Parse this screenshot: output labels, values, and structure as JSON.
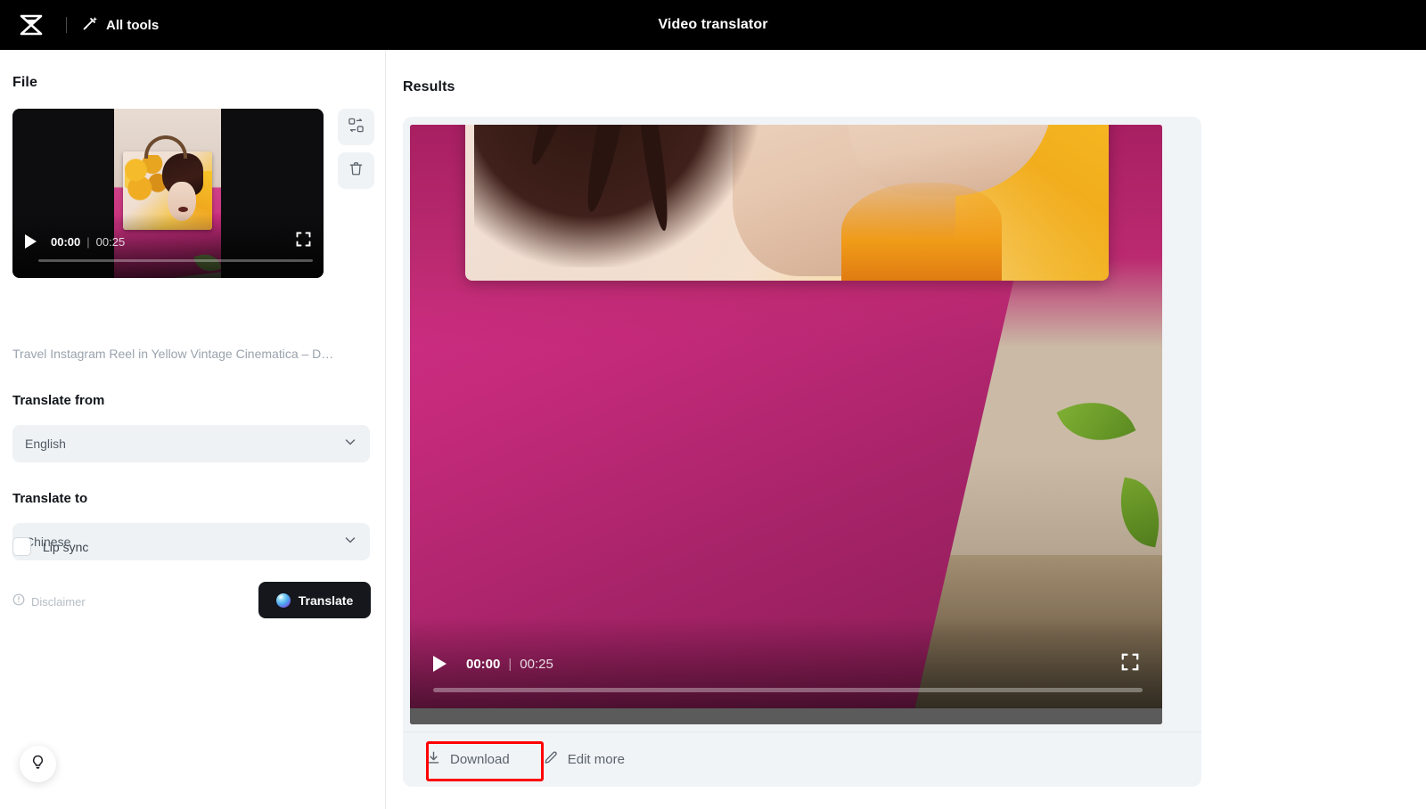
{
  "topbar": {
    "logo_icon": "capcut-logo-icon",
    "all_tools_icon": "magic-wand-icon",
    "all_tools_label": "All tools",
    "title": "Video translator"
  },
  "left_panel": {
    "file_section_title": "File",
    "file_preview": {
      "play_icon": "play-icon",
      "current_time": "00:00",
      "time_separator": "|",
      "total_time": "00:25",
      "fullscreen_icon": "fullscreen-icon"
    },
    "file_actions": [
      {
        "icon": "replace-media-icon",
        "name": "replace-file-button"
      },
      {
        "icon": "trash-icon",
        "name": "delete-file-button"
      }
    ],
    "file_name": "Travel Instagram Reel in Yellow Vintage Cinematica – D…",
    "translate_from": {
      "label": "Translate from",
      "value": "English",
      "chevron_icon": "chevron-down-icon"
    },
    "translate_to": {
      "label": "Translate to",
      "value": "Chinese",
      "chevron_icon": "chevron-down-icon"
    },
    "lip_sync": {
      "label": "Lip sync",
      "checked": false
    },
    "disclaimer": {
      "icon": "info-icon",
      "label": "Disclaimer"
    },
    "translate_button": {
      "icon": "ai-sphere-icon",
      "label": "Translate",
      "background": "#15171d"
    },
    "help_button": {
      "icon": "lightbulb-icon"
    }
  },
  "results": {
    "title": "Results",
    "player": {
      "play_icon": "play-icon",
      "current_time": "00:00",
      "time_separator": "|",
      "total_time": "00:25",
      "fullscreen_icon": "fullscreen-icon"
    },
    "actions": [
      {
        "icon": "download-icon",
        "label": "Download",
        "name": "download-button",
        "highlighted": true
      },
      {
        "icon": "pencil-icon",
        "label": "Edit more",
        "name": "edit-more-button",
        "highlighted": false
      }
    ],
    "highlight_color": "#ff0000"
  }
}
